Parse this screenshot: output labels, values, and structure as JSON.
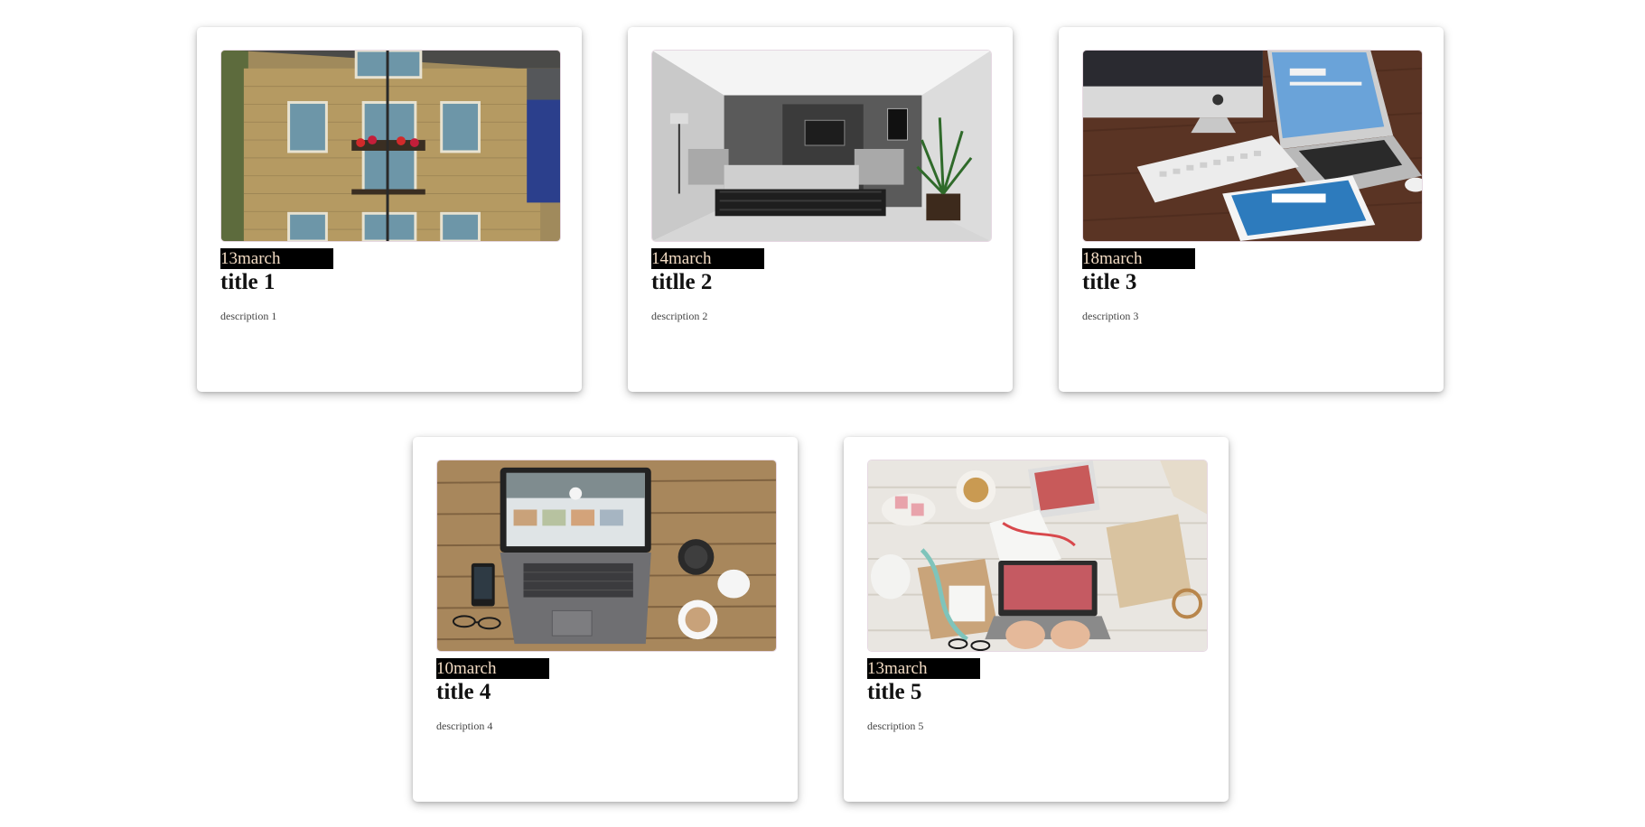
{
  "cards": [
    {
      "date": "13march",
      "title": "title 1",
      "description": "description 1",
      "image": "brick-house-photo"
    },
    {
      "date": "14march",
      "title": "titlle 2",
      "description": "description 2",
      "image": "living-room-photo"
    },
    {
      "date": "18march",
      "title": "title 3",
      "description": "description 3",
      "image": "apple-devices-desk-photo"
    },
    {
      "date": "10march",
      "title": "title 4",
      "description": "description 4",
      "image": "laptop-coffee-table-photo"
    },
    {
      "date": "13march",
      "title": "title 5",
      "description": "description 5",
      "image": "workspace-gift-wrap-photo"
    }
  ],
  "colors": {
    "date_badge_bg": "#000000",
    "date_badge_text": "#f3dcc4",
    "card_bg": "#ffffff"
  }
}
